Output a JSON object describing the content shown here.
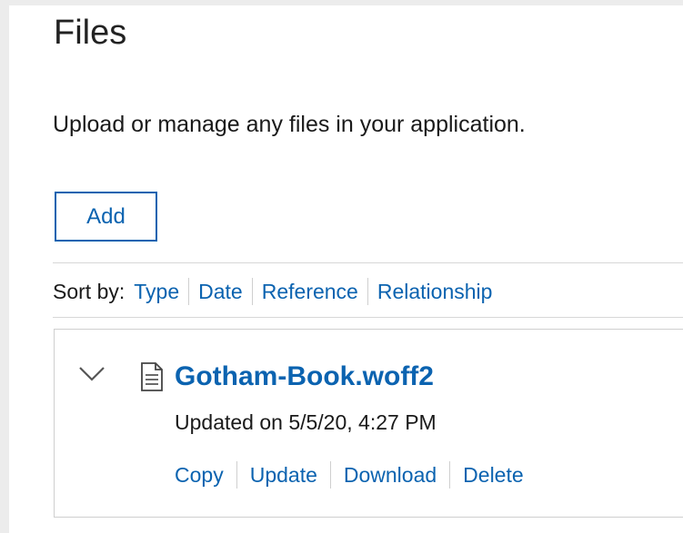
{
  "page": {
    "title": "Files",
    "description": "Upload or manage any files in your application.",
    "add_label": "Add"
  },
  "sort": {
    "label": "Sort by:",
    "options": [
      "Type",
      "Date",
      "Reference",
      "Relationship"
    ]
  },
  "file": {
    "name": "Gotham-Book.woff2",
    "updated": "Updated on 5/5/20, 4:27 PM",
    "actions": [
      "Copy",
      "Update",
      "Download",
      "Delete"
    ],
    "expand_icon": "chevron-down-icon",
    "type_icon": "document-icon"
  },
  "colors": {
    "link": "#0b63b0",
    "text": "#1a1a1a",
    "border": "#cfcfcf"
  }
}
